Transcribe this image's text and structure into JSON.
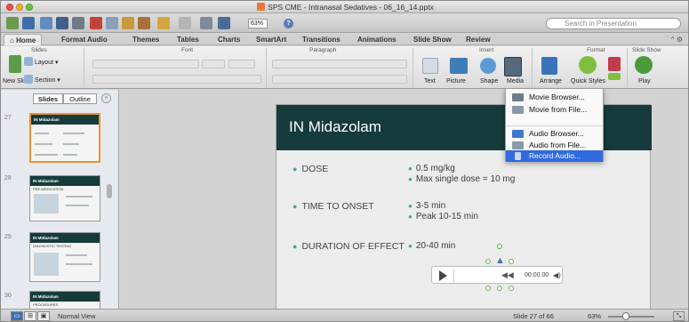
{
  "window": {
    "title": "SPS CME - Intranasal Sedatives - 06_16_14.pptx"
  },
  "toolbar": {
    "zoom_value": "63%",
    "search_placeholder": "Search in Presentation"
  },
  "ribbon_tabs": [
    "Home",
    "Format Audio",
    "Themes",
    "Tables",
    "Charts",
    "SmartArt",
    "Transitions",
    "Animations",
    "Slide Show",
    "Review"
  ],
  "ribbon": {
    "groups": {
      "slides": "Slides",
      "font": "Font",
      "paragraph": "Paragraph",
      "insert": "Insert",
      "format": "Format",
      "slide_show": "Slide Show"
    },
    "layout_label": "Layout",
    "new_slide_label": "New Slide",
    "section_label": "Section",
    "text_label": "Text",
    "picture_label": "Picture",
    "shape_label": "Shape",
    "media_label": "Media",
    "arrange_label": "Arrange",
    "quick_styles_label": "Quick Styles",
    "play_label": "Play"
  },
  "media_menu": {
    "items": [
      "Movie Browser...",
      "Movie from File...",
      "Audio Browser...",
      "Audio from File...",
      "Record Audio..."
    ],
    "highlighted": "Record Audio..."
  },
  "left_pane": {
    "tabs": [
      "Slides",
      "Outline"
    ],
    "thumbnails": [
      {
        "number": "27",
        "title": "IN Midazolam"
      },
      {
        "number": "28",
        "title": "IN Midazolam",
        "subtitle": "PRE-MEDICATION"
      },
      {
        "number": "29",
        "title": "IN Midazolam",
        "subtitle": "DIAGNOSTIC TESTING"
      },
      {
        "number": "30",
        "title": "IN Midazolam",
        "subtitle": "PROCEDURES"
      }
    ]
  },
  "slide": {
    "title": "IN Midazolam",
    "rows": [
      {
        "label": "DOSE",
        "values": [
          "0.5 mg/kg",
          "Max single dose = 10 mg"
        ]
      },
      {
        "label": "TIME TO ONSET",
        "values": [
          "3-5 min",
          "Peak 10-15 min"
        ]
      },
      {
        "label": "DURATION OF EFFECT",
        "values": [
          "20-40 min"
        ]
      }
    ]
  },
  "audio": {
    "time": "00:00.00"
  },
  "status_bar": {
    "view_name": "Normal View",
    "slide_position": "Slide 27 of 66",
    "zoom": "63%"
  },
  "colors": {
    "slide_header": "#153b3c",
    "bullet_accent": "#47a3a8",
    "menu_highlight": "#2f6ae1",
    "selected_thumb": "#f0912f"
  }
}
